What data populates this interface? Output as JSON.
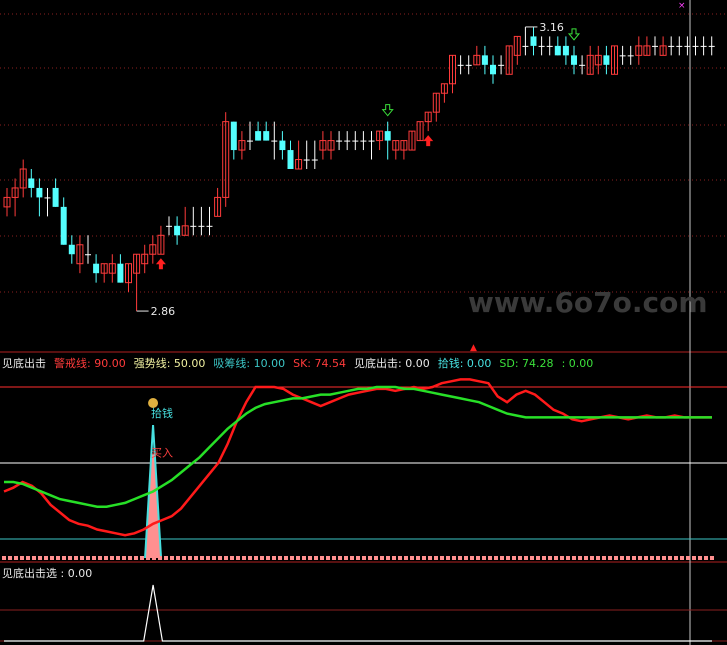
{
  "colors": {
    "background": "#000000",
    "up_candle": "#ff3b3b",
    "down_candle": "#54ffff",
    "doji": "#ffffff",
    "grid_dotted": "#8a2020",
    "panel_sep": "#b02020",
    "warning_line": "#ff2e2e",
    "strong_line": "#ffffff",
    "absorb_line": "#3cc6c6",
    "sk_line": "#ff1a1a",
    "sd_line": "#27e027",
    "money_bar": "#ff9090",
    "money_line": "#47e0e0",
    "signal_line": "#ffffff",
    "watermark": "#3a3a3a",
    "high_label": "#e8e8e8"
  },
  "watermark": "www.6o7o.com",
  "price_panel": {
    "high_label": "3.16",
    "low_label": "2.86"
  },
  "indicator_panel": {
    "legend": [
      {
        "text": "见底出击",
        "color": "#e8e8e8"
      },
      {
        "text": "警戒线: 90.00",
        "color": "#ff3b3b"
      },
      {
        "text": "强势线: 50.00",
        "color": "#f0f0a0"
      },
      {
        "text": "吸筹线: 10.00",
        "color": "#3cc6c6"
      },
      {
        "text": "SK: 74.54",
        "color": "#ff3b3b"
      },
      {
        "text": "见底出击: 0.00",
        "color": "#e8e8e8"
      },
      {
        "text": "拾钱: 0.00",
        "color": "#47e0e0"
      },
      {
        "text": "SD: 74.28",
        "color": "#3be03b"
      },
      {
        "text": ": 0.00",
        "color": "#3be03b"
      }
    ],
    "money_label": "拾钱",
    "buy_label": "买入",
    "money_bag_icon": "money-bag-icon"
  },
  "signal_panel": {
    "legend": "见底出击选 : 0.00"
  },
  "chart_data": [
    {
      "type": "candlestick",
      "title": "",
      "high": 3.16,
      "low": 2.86,
      "ylim": [
        2.84,
        3.18
      ],
      "candles": [
        [
          2.97,
          2.99,
          2.96,
          2.98
        ],
        [
          2.98,
          3.0,
          2.96,
          2.99
        ],
        [
          2.99,
          3.02,
          2.98,
          3.01
        ],
        [
          3.0,
          3.01,
          2.98,
          2.99
        ],
        [
          2.99,
          3.0,
          2.96,
          2.98
        ],
        [
          2.98,
          2.99,
          2.96,
          2.98
        ],
        [
          2.99,
          3.0,
          2.97,
          2.97
        ],
        [
          2.97,
          2.98,
          2.93,
          2.93
        ],
        [
          2.93,
          2.94,
          2.91,
          2.92
        ],
        [
          2.91,
          2.94,
          2.9,
          2.93
        ],
        [
          2.92,
          2.94,
          2.91,
          2.92
        ],
        [
          2.91,
          2.92,
          2.89,
          2.9
        ],
        [
          2.9,
          2.91,
          2.89,
          2.91
        ],
        [
          2.9,
          2.92,
          2.89,
          2.91
        ],
        [
          2.91,
          2.92,
          2.89,
          2.89
        ],
        [
          2.89,
          2.91,
          2.88,
          2.91
        ],
        [
          2.9,
          2.92,
          2.86,
          2.92
        ],
        [
          2.91,
          2.93,
          2.9,
          2.92
        ],
        [
          2.92,
          2.94,
          2.91,
          2.93
        ],
        [
          2.92,
          2.95,
          2.92,
          2.94
        ],
        [
          2.95,
          2.96,
          2.94,
          2.95
        ],
        [
          2.95,
          2.96,
          2.93,
          2.94
        ],
        [
          2.94,
          2.97,
          2.94,
          2.95
        ],
        [
          2.95,
          2.97,
          2.94,
          2.95
        ],
        [
          2.95,
          2.97,
          2.94,
          2.95
        ],
        [
          2.95,
          2.97,
          2.94,
          2.95
        ],
        [
          2.96,
          2.99,
          2.96,
          2.98
        ],
        [
          2.98,
          3.07,
          2.97,
          3.06
        ],
        [
          3.06,
          3.06,
          3.02,
          3.03
        ],
        [
          3.03,
          3.05,
          3.02,
          3.04
        ],
        [
          3.04,
          3.06,
          3.03,
          3.04
        ],
        [
          3.05,
          3.06,
          3.04,
          3.04
        ],
        [
          3.05,
          3.06,
          3.04,
          3.04
        ],
        [
          3.04,
          3.06,
          3.02,
          3.04
        ],
        [
          3.04,
          3.05,
          3.02,
          3.03
        ],
        [
          3.03,
          3.04,
          3.01,
          3.01
        ],
        [
          3.01,
          3.04,
          3.01,
          3.02
        ],
        [
          3.02,
          3.04,
          3.01,
          3.02
        ],
        [
          3.02,
          3.04,
          3.01,
          3.02
        ],
        [
          3.03,
          3.05,
          3.02,
          3.04
        ],
        [
          3.03,
          3.05,
          3.02,
          3.04
        ],
        [
          3.04,
          3.05,
          3.03,
          3.04
        ],
        [
          3.04,
          3.05,
          3.03,
          3.04
        ],
        [
          3.04,
          3.05,
          3.03,
          3.04
        ],
        [
          3.04,
          3.05,
          3.03,
          3.04
        ],
        [
          3.04,
          3.05,
          3.02,
          3.04
        ],
        [
          3.04,
          3.05,
          3.03,
          3.05
        ],
        [
          3.05,
          3.06,
          3.02,
          3.04
        ],
        [
          3.03,
          3.04,
          3.02,
          3.04
        ],
        [
          3.03,
          3.04,
          3.02,
          3.04
        ],
        [
          3.03,
          3.05,
          3.03,
          3.05
        ],
        [
          3.04,
          3.06,
          3.04,
          3.06
        ],
        [
          3.06,
          3.07,
          3.05,
          3.07
        ],
        [
          3.07,
          3.09,
          3.06,
          3.09
        ],
        [
          3.09,
          3.1,
          3.08,
          3.1
        ],
        [
          3.1,
          3.13,
          3.09,
          3.13
        ],
        [
          3.12,
          3.13,
          3.11,
          3.12
        ],
        [
          3.12,
          3.13,
          3.11,
          3.12
        ],
        [
          3.12,
          3.14,
          3.12,
          3.13
        ],
        [
          3.13,
          3.14,
          3.11,
          3.12
        ],
        [
          3.12,
          3.13,
          3.1,
          3.11
        ],
        [
          3.12,
          3.13,
          3.11,
          3.12
        ],
        [
          3.11,
          3.14,
          3.11,
          3.14
        ],
        [
          3.13,
          3.15,
          3.12,
          3.15
        ],
        [
          3.14,
          3.16,
          3.13,
          3.14
        ],
        [
          3.15,
          3.16,
          3.13,
          3.14
        ],
        [
          3.14,
          3.15,
          3.13,
          3.14
        ],
        [
          3.14,
          3.15,
          3.13,
          3.14
        ],
        [
          3.14,
          3.15,
          3.13,
          3.13
        ],
        [
          3.14,
          3.15,
          3.12,
          3.13
        ],
        [
          3.13,
          3.14,
          3.11,
          3.12
        ],
        [
          3.12,
          3.13,
          3.11,
          3.12
        ],
        [
          3.11,
          3.14,
          3.11,
          3.13
        ],
        [
          3.12,
          3.14,
          3.11,
          3.13
        ],
        [
          3.13,
          3.14,
          3.11,
          3.12
        ],
        [
          3.11,
          3.14,
          3.11,
          3.14
        ],
        [
          3.13,
          3.14,
          3.12,
          3.13
        ],
        [
          3.13,
          3.14,
          3.12,
          3.13
        ],
        [
          3.13,
          3.15,
          3.12,
          3.14
        ],
        [
          3.13,
          3.15,
          3.13,
          3.14
        ],
        [
          3.14,
          3.15,
          3.13,
          3.14
        ],
        [
          3.13,
          3.15,
          3.13,
          3.14
        ],
        [
          3.14,
          3.15,
          3.13,
          3.14
        ],
        [
          3.14,
          3.15,
          3.13,
          3.14
        ],
        [
          3.14,
          3.15,
          3.13,
          3.14
        ],
        [
          3.14,
          3.15,
          3.13,
          3.14
        ],
        [
          3.14,
          3.15,
          3.13,
          3.14
        ],
        [
          3.14,
          3.15,
          3.13,
          3.14
        ]
      ],
      "buy_arrows": [
        19,
        52
      ],
      "sell_arrows": [
        47,
        70
      ],
      "gridlines": "dotted"
    },
    {
      "type": "line",
      "title": "见底出击",
      "ylim": [
        0,
        100
      ],
      "reference_lines": {
        "warning": 90,
        "strong": 50,
        "absorb": 10
      },
      "series": [
        {
          "name": "SK",
          "values": [
            35,
            37,
            40,
            38,
            34,
            28,
            24,
            20,
            18,
            17,
            15,
            14,
            13,
            12,
            13,
            15,
            18,
            20,
            22,
            26,
            32,
            38,
            44,
            50,
            60,
            72,
            82,
            90,
            90,
            90,
            89,
            86,
            84,
            82,
            80,
            82,
            84,
            86,
            87,
            88,
            89,
            89,
            88,
            89,
            90,
            89,
            90,
            92,
            93,
            94,
            94,
            93,
            92,
            85,
            82,
            86,
            88,
            86,
            82,
            78,
            76,
            73,
            72,
            73,
            74,
            75,
            74,
            73,
            74,
            75,
            74,
            74,
            75,
            74,
            74,
            74,
            74
          ]
        },
        {
          "name": "SD",
          "values": [
            40,
            40,
            39,
            37,
            35,
            33,
            31,
            30,
            29,
            28,
            27,
            27,
            28,
            29,
            31,
            33,
            35,
            38,
            41,
            45,
            49,
            53,
            58,
            63,
            68,
            72,
            76,
            79,
            81,
            82,
            83,
            84,
            84,
            85,
            86,
            86,
            87,
            88,
            89,
            89,
            90,
            90,
            90,
            89,
            89,
            88,
            87,
            86,
            85,
            84,
            83,
            82,
            80,
            78,
            76,
            75,
            74,
            74,
            74,
            74,
            74,
            74,
            74,
            74,
            74,
            74,
            74,
            74,
            74,
            74,
            74,
            74,
            74,
            74,
            74,
            74,
            74
          ]
        }
      ],
      "money_spike": {
        "index": 16,
        "value": 70
      },
      "buy_marker_index": 16
    },
    {
      "type": "line",
      "title": "见底出击选",
      "ylim": [
        0,
        1
      ],
      "series": [
        {
          "name": "见底出击选",
          "values": [
            0,
            0,
            0,
            0,
            0,
            0,
            0,
            0,
            0,
            0,
            0,
            0,
            0,
            0,
            0,
            0,
            1,
            0,
            0,
            0,
            0,
            0,
            0,
            0,
            0,
            0,
            0,
            0,
            0,
            0,
            0,
            0,
            0,
            0,
            0,
            0,
            0,
            0,
            0,
            0,
            0,
            0,
            0,
            0,
            0,
            0,
            0,
            0,
            0,
            0,
            0,
            0,
            0,
            0,
            0,
            0,
            0,
            0,
            0,
            0,
            0,
            0,
            0,
            0,
            0,
            0,
            0,
            0,
            0,
            0,
            0,
            0,
            0,
            0,
            0,
            0,
            0
          ]
        }
      ]
    }
  ]
}
